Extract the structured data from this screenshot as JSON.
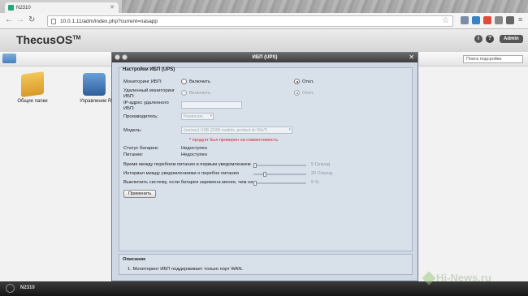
{
  "browser": {
    "tab_title": "N2310",
    "url": "10.0.1.11/adm/index.php?current=nasapp"
  },
  "app": {
    "brand": "ThecusOS",
    "brand_tm": "TM",
    "admin_label": "Admin",
    "search_placeholder": "Поиск подсройки"
  },
  "desktop_icons": [
    {
      "label": "Общие папки"
    },
    {
      "label": "Управление R"
    }
  ],
  "taskbar": {
    "label": "N2310"
  },
  "watermark": "Hi-News.ru",
  "dialog": {
    "title": "ИБП (UPS)",
    "section_title": "Настройки ИБП (UPS)",
    "fields": {
      "monitoring_label": "Мониторинг ИБП:",
      "remote_label": "Удаленный мониторинг ИБП:",
      "ip_label": "IP-адрес удаленного ИБП:",
      "vendor_label": "Производитель:",
      "model_label": "Модель:",
      "enable": "Включить",
      "off": "Откл.",
      "vendor_value": "Powercom",
      "model_value": "(various) USB (2009 models, product id: 00a?)",
      "warning": "* продукт был проверен на совместимость"
    },
    "status": {
      "battery_label": "Статус батареи:",
      "battery_value": "Недоступен",
      "power_label": "Питание:",
      "power_value": "Недоступен"
    },
    "sliders": [
      {
        "label": "Время между перебоем питания и первым уведомлением",
        "value": "5 Секунд",
        "level": 0.0
      },
      {
        "label": "Интервал между уведомлениями о перебое питания",
        "value": "20 Секунд",
        "level": 0.2
      },
      {
        "label": "Выключить систему, если батарея заряжена менее, чем на",
        "value": "5 %",
        "level": 0.0
      }
    ],
    "apply_label": "Применить",
    "description_title": "Описание",
    "description_text": "1. Мониторинг ИБП поддерживает только порт WAN."
  },
  "colors": {
    "dialog_bg": "#cfd8e4",
    "warning": "#dd2233",
    "titlebar": "#3c3c3c"
  }
}
